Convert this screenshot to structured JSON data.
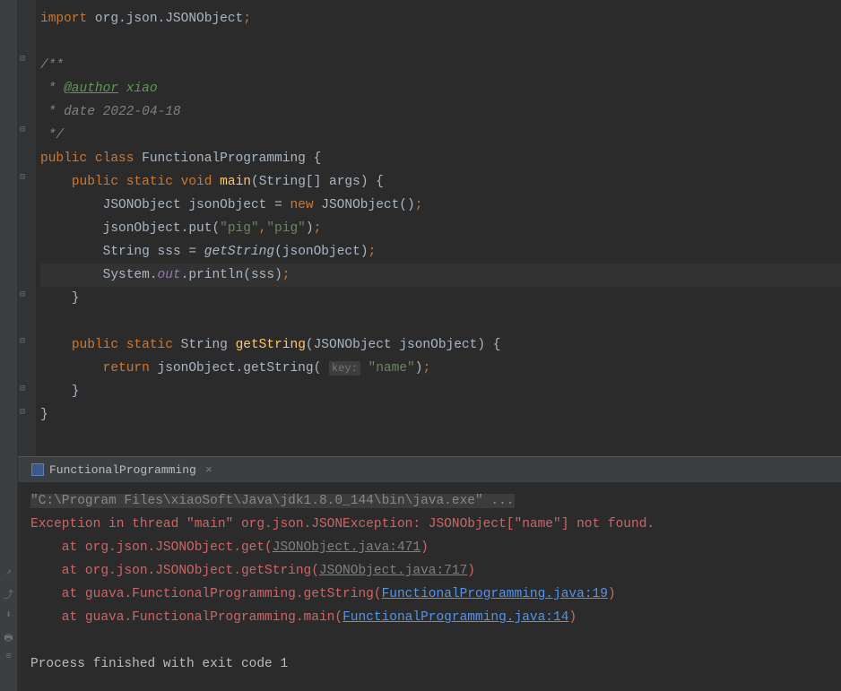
{
  "code": {
    "import_kw": "import",
    "import_pkg": " org.json.JSONObject",
    "doc_open": "/**",
    "doc_author_tag": "@author",
    "doc_author_val": " xiao",
    "doc_date": " * date 2022-04-18",
    "doc_close": " */",
    "public": "public",
    "class": "class",
    "classname": " FunctionalProgramming ",
    "static": "static",
    "void": "void",
    "main": "main",
    "main_args": "String[] args",
    "jsonobj_type": "JSONObject",
    "jsonobj_var": " jsonObject ",
    "new_kw": "new",
    "jsonobj_ctor": " JSONObject",
    "put_method": "put",
    "str_pig1": "\"pig\"",
    "str_pig2": "\"pig\"",
    "string_type": "String",
    "sss_var": " sss ",
    "getstring_call": "getString",
    "jsonobj_arg": "jsonObject",
    "system": "System.",
    "out_field": "out",
    "println": ".println",
    "sss_arg": "sss",
    "return_kw": "return",
    "getstring_method": "getString",
    "key_hint": "key:",
    "str_name": "\"name\"",
    "getstring_def": "getString",
    "jsonobj_param": "JSONObject jsonObject"
  },
  "console": {
    "tab_label": "FunctionalProgramming",
    "cmd": "\"C:\\Program Files\\xiaoSoft\\Java\\jdk1.8.0_144\\bin\\java.exe\" ...",
    "exception": "Exception in thread \"main\" org.json.JSONException: JSONObject[\"name\"] not found.",
    "at1_pre": "    at org.json.JSONObject.get(",
    "at1_link": "JSONObject.java:471",
    "at2_pre": "    at org.json.JSONObject.getString(",
    "at2_link": "JSONObject.java:717",
    "at3_pre": "    at guava.FunctionalProgramming.getString(",
    "at3_link": "FunctionalProgramming.java:19",
    "at4_pre": "    at guava.FunctionalProgramming.main(",
    "at4_link": "FunctionalProgramming.java:14",
    "close_paren": ")",
    "exit": "Process finished with exit code 1"
  }
}
